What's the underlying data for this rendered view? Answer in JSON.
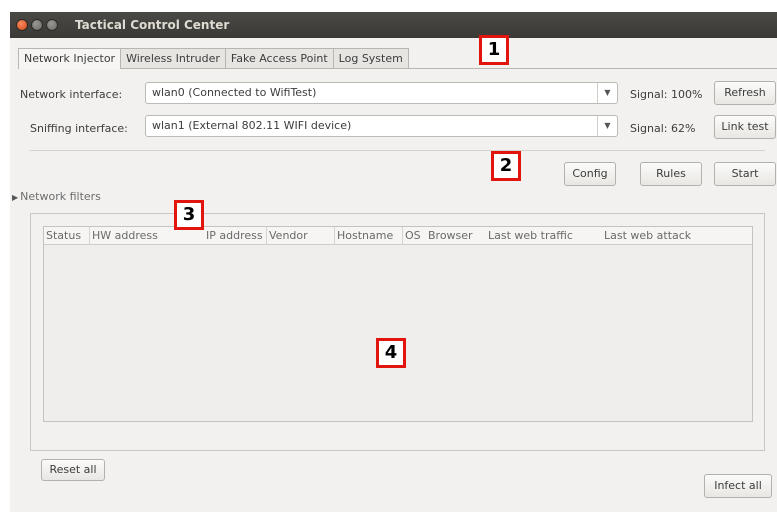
{
  "window": {
    "title": "Tactical Control Center"
  },
  "tabs": [
    {
      "label": "Network Injector",
      "active": true
    },
    {
      "label": "Wireless Intruder",
      "active": false
    },
    {
      "label": "Fake Access Point",
      "active": false
    },
    {
      "label": "Log System",
      "active": false
    }
  ],
  "network_interface": {
    "label": "Network interface:",
    "value": "wlan0 (Connected to WifiTest)",
    "signal": "Signal: 100%",
    "button": "Refresh"
  },
  "sniffing_interface": {
    "label": "Sniffing interface:",
    "value": "wlan1 (External 802.11 WIFI device)",
    "signal": "Signal: 62%",
    "button": "Link test"
  },
  "actions": {
    "config": "Config",
    "rules": "Rules",
    "start": "Start"
  },
  "filters": {
    "label": "Network filters"
  },
  "table": {
    "columns": [
      "Status",
      "HW address",
      "IP address",
      "Vendor",
      "Hostname",
      "OS",
      "Browser",
      "Last web traffic",
      "Last web attack"
    ],
    "rows": []
  },
  "buttons": {
    "reset_all": "Reset all",
    "infect_all": "Infect all"
  },
  "markers": [
    "1",
    "2",
    "3",
    "4"
  ],
  "colors": {
    "marker_border": "#e1150e",
    "titlebar": "#3c3b37",
    "close_button": "#e9541f"
  }
}
